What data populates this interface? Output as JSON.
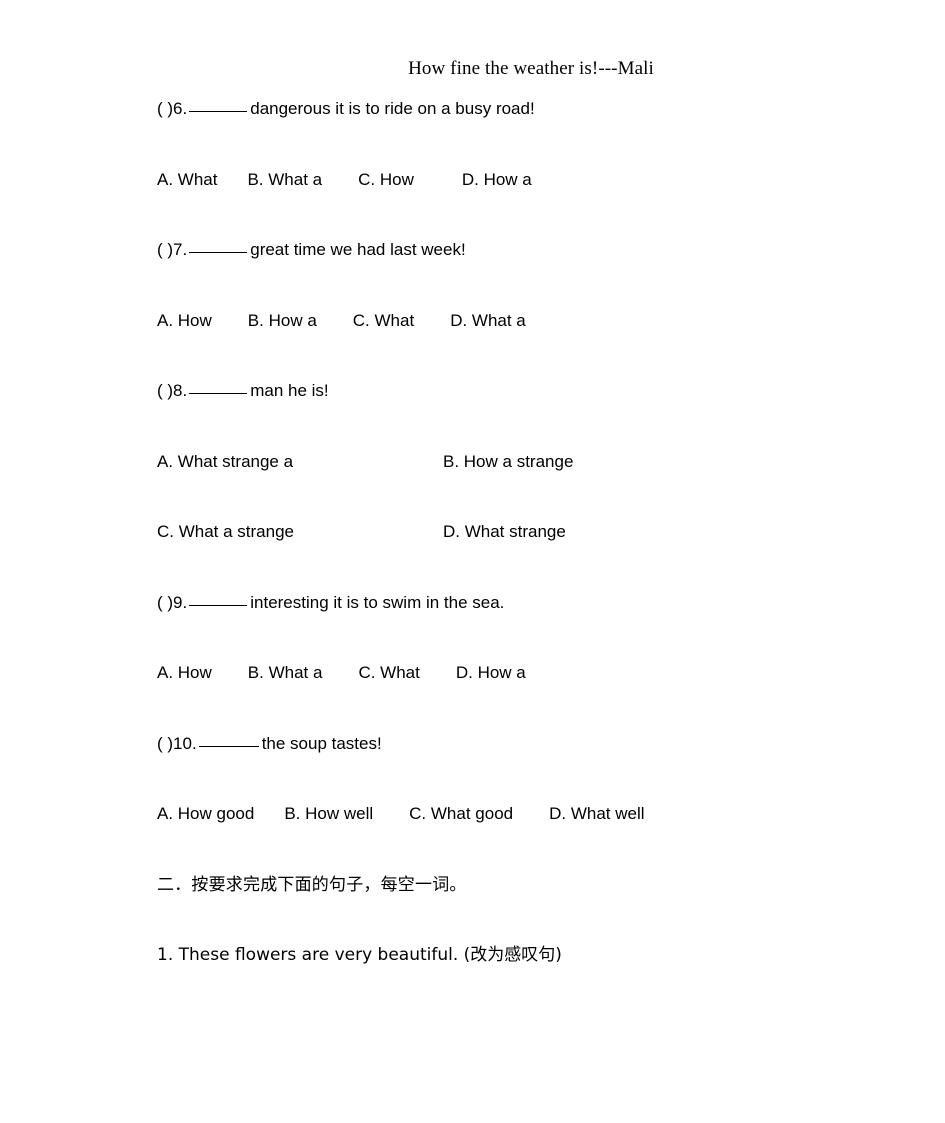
{
  "document": {
    "title": "How fine the weather is!---Mali",
    "background_color": "#ffffff",
    "text_color": "#000000"
  },
  "questions": [
    {
      "marker": "(   )6.",
      "blank": "______",
      "stem": "dangerous it is to ride on a busy road!",
      "layout": "one-row",
      "options": [
        {
          "label": "A. What"
        },
        {
          "label": "B. What a"
        },
        {
          "label": "C. How"
        },
        {
          "label": "D. How a"
        }
      ]
    },
    {
      "marker": "(   )7.",
      "blank": "______",
      "stem": "great time we had last week!",
      "layout": "one-row",
      "options": [
        {
          "label": "A. How"
        },
        {
          "label": "B. How a"
        },
        {
          "label": "C. What"
        },
        {
          "label": "D. What a"
        }
      ]
    },
    {
      "marker": "(   )8.",
      "blank": "______",
      "stem": "man he is!",
      "layout": "two-rows",
      "options": [
        {
          "label": "A. What strange a"
        },
        {
          "label": "B. How a strange"
        },
        {
          "label": "C. What a strange"
        },
        {
          "label": "D. What strange"
        }
      ]
    },
    {
      "marker": "(   )9.",
      "blank": "______",
      "stem": "interesting it is to swim in the sea.",
      "layout": "one-row",
      "options": [
        {
          "label": "A. How"
        },
        {
          "label": "B. What a"
        },
        {
          "label": "C. What"
        },
        {
          "label": "D. How a"
        }
      ]
    },
    {
      "marker": "(   )10.",
      "blank": "______",
      "stem": "the soup tastes!",
      "layout": "one-row",
      "options": [
        {
          "label": "A. How good"
        },
        {
          "label": "B. How well"
        },
        {
          "label": "C. What good"
        },
        {
          "label": "D. What well"
        }
      ]
    }
  ],
  "section_two": {
    "heading": "二．按要求完成下面的句子，每空一词。",
    "tasks": [
      {
        "text": "1. These flowers are very beautiful. (改为感叹句)"
      }
    ]
  }
}
